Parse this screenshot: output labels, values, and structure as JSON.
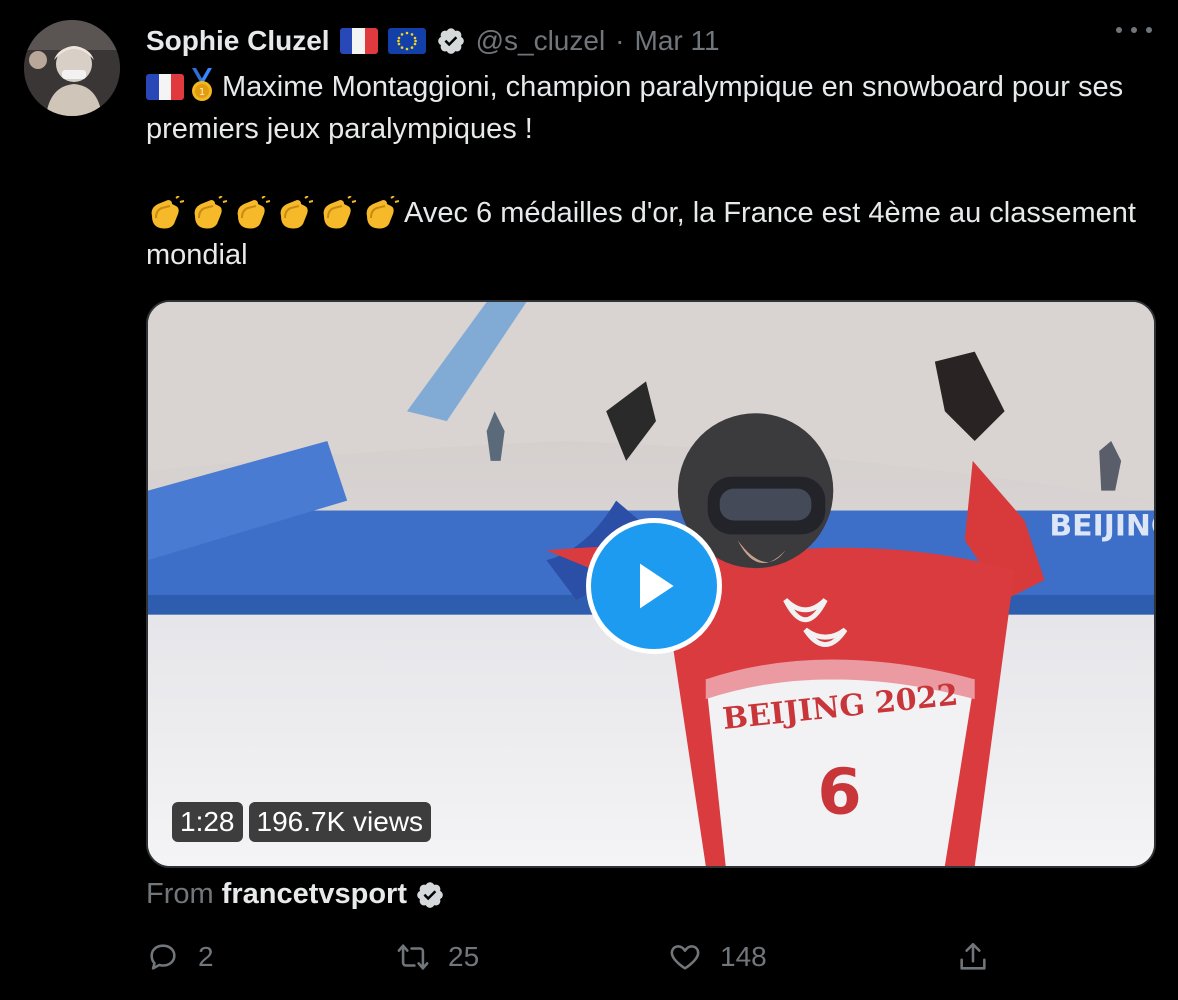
{
  "tweet": {
    "author": {
      "name": "Sophie Cluzel",
      "handle": "@s_cluzel",
      "separator": "·",
      "date": "Mar 11"
    },
    "text": {
      "line1": "Maxime Montaggioni, champion paralympique en snowboard pour ses premiers jeux paralympiques !",
      "line2": "Avec 6 médailles d'or, la France est 4ème au classement mondial"
    },
    "media": {
      "duration": "1:28",
      "views": "196.7K views",
      "bib_text": "BEIJING 2022",
      "bib_number": "6",
      "banner_text": "BEIJING"
    },
    "source": {
      "prefix": "From",
      "account": "francetvsport"
    },
    "actions": {
      "replies": "2",
      "retweets": "25",
      "likes": "148"
    },
    "icons": [
      "avatar",
      "france-flag-icon",
      "eu-flag-icon",
      "verified-icon",
      "more-icon",
      "medal-icon",
      "clapping-hands-icon",
      "play-icon",
      "reply-icon",
      "retweet-icon",
      "like-icon",
      "share-icon"
    ],
    "colors": {
      "accent": "#1d9bf0",
      "muted": "#71767b",
      "text": "#e7e9ea",
      "background": "#000000"
    }
  }
}
